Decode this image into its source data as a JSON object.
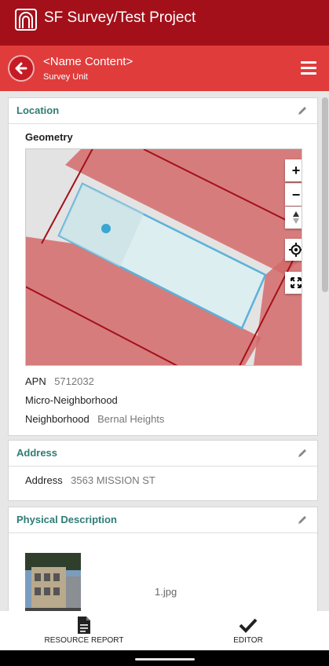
{
  "app": {
    "title": "SF Survey/Test Project"
  },
  "header": {
    "title": "<Name Content>",
    "subtitle": "Survey Unit"
  },
  "location": {
    "section_title": "Location",
    "geometry_label": "Geometry",
    "apn_label": "APN",
    "apn_value": "5712032",
    "micro_label": "Micro-Neighborhood",
    "neighborhood_label": "Neighborhood",
    "neighborhood_value": "Bernal Heights",
    "map_controls": [
      "+",
      "−"
    ]
  },
  "address": {
    "section_title": "Address",
    "address_label": "Address",
    "address_value": "3563 MISSION ST"
  },
  "physical": {
    "section_title": "Physical Description",
    "file_name": "1.jpg"
  },
  "bottom_nav": [
    {
      "label": "RESOURCE REPORT",
      "icon": "document-icon"
    },
    {
      "label": "EDITOR",
      "icon": "checkmark-icon"
    }
  ],
  "colors": {
    "topbar": "#a3101a",
    "subbar": "#e03c3c",
    "section_title": "#2d7d73",
    "parcel_fill": "#d36a6a",
    "selected_parcel": "#5bb2d9"
  }
}
